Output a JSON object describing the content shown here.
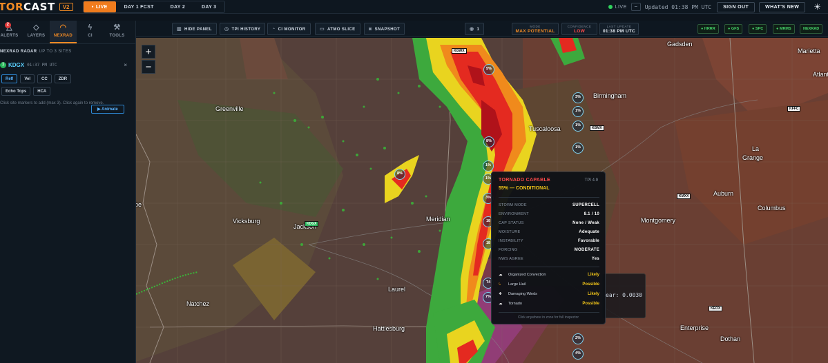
{
  "brand": {
    "tor": "TOR",
    "cast": "CAST",
    "version": "V2"
  },
  "nav_tabs": [
    "LIVE",
    "DAY 1 FCST",
    "DAY 2",
    "DAY 3"
  ],
  "status": {
    "live_label": "LIVE",
    "minus": "−",
    "updated": "Updated 01:38 PM UTC",
    "sign_out": "SIGN OUT",
    "whats_new": "WHAT'S NEW",
    "theme_icon": "sun-icon"
  },
  "sidebar": {
    "tabs": [
      {
        "label": "ALERTS",
        "icon": "alert-icon",
        "badge": "2"
      },
      {
        "label": "LAYERS",
        "icon": "layers-icon"
      },
      {
        "label": "NEXRAD",
        "icon": "radar-icon"
      },
      {
        "label": "CI",
        "icon": "lightning-icon"
      },
      {
        "label": "TOOLS",
        "icon": "wrench-icon"
      }
    ],
    "section_title": "NEXRAD RADAR",
    "section_sub": "UP TO 3 SITES",
    "site": {
      "num": "1",
      "id": "KDGX",
      "time": "01:37 PM UTC",
      "close": "×"
    },
    "products": [
      "Refl",
      "Vel",
      "CC",
      "ZDR",
      "Echo Tops",
      "HCA"
    ],
    "active_product": "Refl",
    "animate": "▶ Animate",
    "hint": "Click site markers to add (max 3). Click again to remove."
  },
  "toolbar": {
    "hide_panel": "HIDE PANEL",
    "tpi_history": "TPI HISTORY",
    "ci_monitor": "CI MONITOR",
    "atmo_slice": "ATMO SLICE",
    "snapshot": "SNAPSHOT",
    "eye_count": "1",
    "mode_label": "MODE",
    "mode_value": "MAX POTENTIAL",
    "confidence_label": "CONFIDENCE",
    "confidence_value": "LOW",
    "last_update_label": "LAST UPDATE",
    "last_update_value": "01:38 PM UTC",
    "sources": [
      "HRRR",
      "GFS",
      "SPC",
      "MRMS"
    ],
    "nexrad": "NEXRAD"
  },
  "map": {
    "zoom_in": "+",
    "zoom_out": "−",
    "cities": [
      "Gadsden",
      "Marietta",
      "Atlant",
      "Birmingham",
      "Greenville",
      "Tuscaloosa",
      "La",
      "Grange",
      "Auburn",
      "Columbus",
      "Vicksburg",
      "Jackson",
      "Meridian",
      "Montgomery",
      "Natchez",
      "Laurel",
      "Hattiesburg",
      "Enterprise",
      "Dothan",
      "be"
    ],
    "radar_sites": [
      "KGWX",
      "KBMX",
      "KFFC",
      "KMXX",
      "KDGX",
      "KEOX"
    ],
    "markers": [
      "5%",
      "3%",
      "1%",
      "1%",
      "8%",
      "1%",
      "8%",
      "1%",
      "1%",
      "3%",
      "18",
      "18",
      "T4",
      "7%",
      "2%",
      "4%"
    ],
    "partial_readout": "ear: 0.0030"
  },
  "popup": {
    "title": "TORNADO CAPABLE",
    "tpi": "TPI 4.9",
    "probability": "55% — CONDITIONAL",
    "rows": [
      {
        "label": "STORM MODE",
        "value": "SUPERCELL"
      },
      {
        "label": "ENVIRONMENT",
        "value": "8.1 / 10"
      },
      {
        "label": "CAP STATUS",
        "value": "None / Weak"
      },
      {
        "label": "MOISTURE",
        "value": "Adequate"
      },
      {
        "label": "INSTABILITY",
        "value": "Favorable"
      },
      {
        "label": "FORCING",
        "value": "MODERATE"
      },
      {
        "label": "NWS AGREE",
        "value": "Yes"
      }
    ],
    "factors": [
      {
        "icon": "tornado-icon",
        "label": "Organized Convection",
        "value": "Likely"
      },
      {
        "icon": "bolt-icon",
        "label": "Large Hail",
        "value": "Possible"
      },
      {
        "icon": "wind-icon",
        "label": "Damaging Winds",
        "value": "Likely"
      },
      {
        "icon": "tornado-icon",
        "label": "Tornado",
        "value": "Possible"
      }
    ],
    "footer": "Click anywhere in zone for full inspector"
  },
  "colors": {
    "accent": "#f08a24",
    "live": "#2fd15c",
    "danger": "#ff4a4a",
    "warning": "#f0c419",
    "link": "#5ab3ff"
  }
}
